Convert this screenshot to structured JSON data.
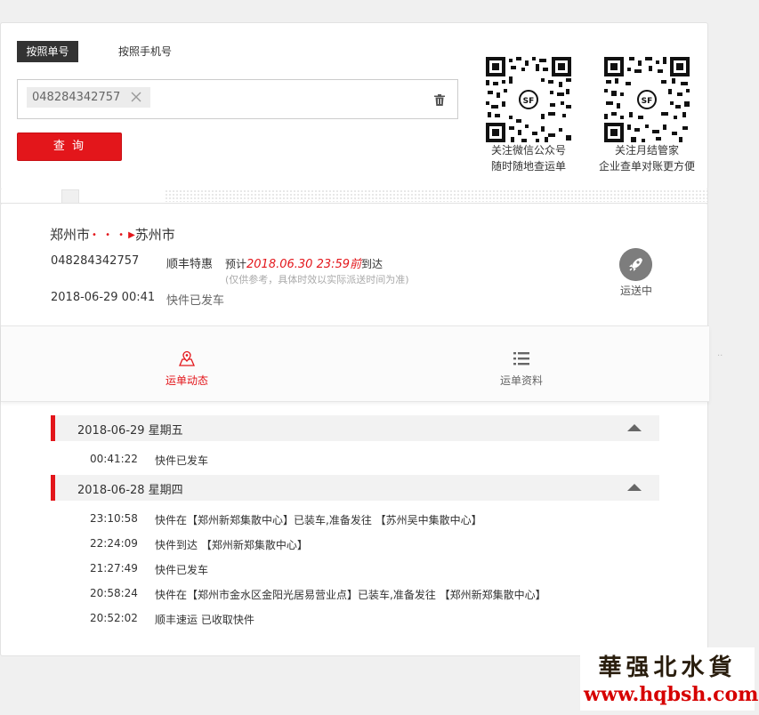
{
  "query": {
    "tab_waybill": "按照单号",
    "tab_phone": "按照手机号",
    "waybill_tag": "048284342757",
    "submit_label": "查 询"
  },
  "qr": [
    {
      "caption1": "关注微信公众号",
      "caption2": "随时随地查运单"
    },
    {
      "caption1": "关注月结管家",
      "caption2": "企业查单对账更方便"
    }
  ],
  "route": {
    "from": "郑州市",
    "dots": "• • •",
    "arrow": "▶",
    "to": "苏州市",
    "waybill_no": "048284342757",
    "product": "顺丰特惠",
    "eta_prefix": "预计",
    "eta_time": "2018.06.30 23:59前",
    "eta_suffix": "到达",
    "eta_note": "(仅供参考，具体时效以实际派送时间为准)",
    "last_time": "2018-06-29 00:41",
    "last_status": "快件已发车",
    "status_label": "运送中"
  },
  "tabs": {
    "tracking": "运单动态",
    "info": "运单资料",
    "active_color": "#e3161b"
  },
  "days": [
    {
      "header": "2018-06-29 星期五",
      "events": [
        {
          "time": "00:41:22",
          "desc": "快件已发车"
        }
      ]
    },
    {
      "header": "2018-06-28 星期四",
      "events": [
        {
          "time": "23:10:58",
          "desc": "快件在【郑州新郑集散中心】已装车,准备发往 【苏州吴中集散中心】"
        },
        {
          "time": "22:24:09",
          "desc": "快件到达 【郑州新郑集散中心】"
        },
        {
          "time": "21:27:49",
          "desc": "快件已发车"
        },
        {
          "time": "20:58:24",
          "desc": "快件在【郑州市金水区金阳光居易营业点】已装车,准备发往 【郑州新郑集散中心】"
        },
        {
          "time": "20:52:02",
          "desc": "顺丰速运 已收取快件"
        }
      ]
    }
  ],
  "watermark": {
    "cn": "華强北水貨",
    "url": "www.hqbsh.com"
  }
}
